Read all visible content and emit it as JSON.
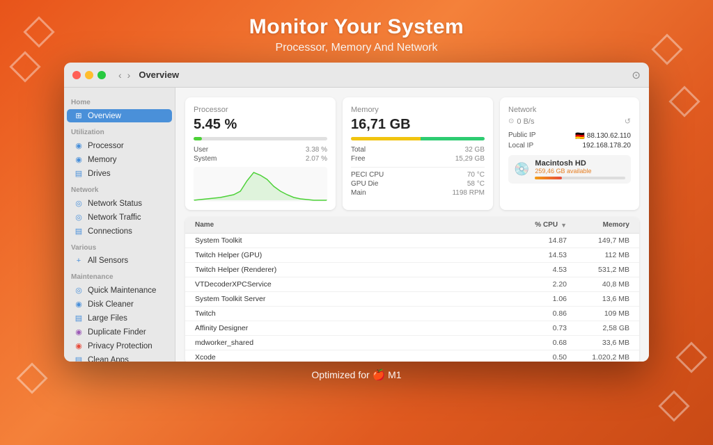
{
  "header": {
    "title": "Monitor Your System",
    "subtitle": "Processor, Memory And Network"
  },
  "window": {
    "title": "Overview"
  },
  "sidebar": {
    "sections": [
      {
        "label": "Home",
        "items": [
          {
            "id": "overview",
            "icon": "⊞",
            "icon_class": "blue",
            "label": "Overview",
            "active": true
          }
        ]
      },
      {
        "label": "Utilization",
        "items": [
          {
            "id": "processor",
            "icon": "◉",
            "icon_class": "blue",
            "label": "Processor",
            "active": false
          },
          {
            "id": "memory",
            "icon": "◉",
            "icon_class": "blue",
            "label": "Memory",
            "active": false
          },
          {
            "id": "drives",
            "icon": "▤",
            "icon_class": "blue",
            "label": "Drives",
            "active": false
          }
        ]
      },
      {
        "label": "Network",
        "items": [
          {
            "id": "network-status",
            "icon": "◎",
            "icon_class": "blue",
            "label": "Network Status",
            "active": false
          },
          {
            "id": "network-traffic",
            "icon": "◎",
            "icon_class": "blue",
            "label": "Network Traffic",
            "active": false
          },
          {
            "id": "connections",
            "icon": "▤",
            "icon_class": "blue",
            "label": "Connections",
            "active": false
          }
        ]
      },
      {
        "label": "Various",
        "items": [
          {
            "id": "all-sensors",
            "icon": "+",
            "icon_class": "blue",
            "label": "All Sensors",
            "active": false
          }
        ]
      },
      {
        "label": "Maintenance",
        "items": [
          {
            "id": "quick-maintenance",
            "icon": "◎",
            "icon_class": "blue",
            "label": "Quick Maintenance",
            "active": false
          },
          {
            "id": "disk-cleaner",
            "icon": "◉",
            "icon_class": "blue",
            "label": "Disk Cleaner",
            "active": false
          },
          {
            "id": "large-files",
            "icon": "▤",
            "icon_class": "blue",
            "label": "Large Files",
            "active": false
          },
          {
            "id": "duplicate-finder",
            "icon": "◉",
            "icon_class": "purple",
            "label": "Duplicate Finder",
            "active": false
          },
          {
            "id": "privacy-protection",
            "icon": "◉",
            "icon_class": "red",
            "label": "Privacy Protection",
            "active": false
          },
          {
            "id": "clean-apps",
            "icon": "▤",
            "icon_class": "blue",
            "label": "Clean Apps",
            "active": false
          }
        ]
      }
    ]
  },
  "processor_card": {
    "title": "Processor",
    "value": "5.45 %",
    "progress_pct": 6,
    "progress_color": "#4cd137",
    "rows": [
      {
        "label": "User",
        "value": "3.38 %"
      },
      {
        "label": "System",
        "value": "2.07 %"
      }
    ]
  },
  "memory_card": {
    "title": "Memory",
    "value": "16,71 GB",
    "rows": [
      {
        "label": "Total",
        "value": "32 GB"
      },
      {
        "label": "Free",
        "value": "15,29 GB"
      }
    ],
    "extra_rows": [
      {
        "label": "PECI CPU",
        "value": "70 °C"
      },
      {
        "label": "GPU Die",
        "value": "58 °C"
      },
      {
        "label": "Main",
        "value": "1198 RPM"
      }
    ]
  },
  "network_card": {
    "title": "Network",
    "speed": "0 B/s",
    "public_ip_label": "Public IP",
    "public_ip": "88.130.62.110",
    "local_ip_label": "Local IP",
    "local_ip": "192.168.178.20",
    "disk": {
      "name": "Macintosh HD",
      "available": "259,46 GB available"
    }
  },
  "process_table": {
    "columns": [
      "Name",
      "% CPU",
      "Memory"
    ],
    "rows": [
      {
        "name": "System Toolkit",
        "cpu": "14.87",
        "mem": "149,7 MB"
      },
      {
        "name": "Twitch Helper (GPU)",
        "cpu": "14.53",
        "mem": "112 MB"
      },
      {
        "name": "Twitch Helper (Renderer)",
        "cpu": "4.53",
        "mem": "531,2 MB"
      },
      {
        "name": "VTDecoderXPCService",
        "cpu": "2.20",
        "mem": "40,8 MB"
      },
      {
        "name": "System Toolkit Server",
        "cpu": "1.06",
        "mem": "13,6 MB"
      },
      {
        "name": "Twitch",
        "cpu": "0.86",
        "mem": "109 MB"
      },
      {
        "name": "Affinity Designer",
        "cpu": "0.73",
        "mem": "2,58 GB"
      },
      {
        "name": "mdworker_shared",
        "cpu": "0.68",
        "mem": "33,6 MB"
      },
      {
        "name": "Xcode",
        "cpu": "0.50",
        "mem": "1.020,2 MB"
      }
    ]
  },
  "footer": {
    "text": "Optimized for  M1"
  }
}
